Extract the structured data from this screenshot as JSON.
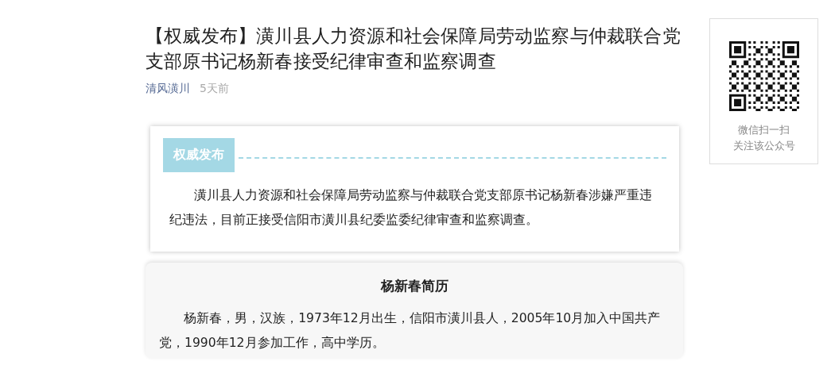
{
  "article": {
    "title": "【权威发布】潢川县人力资源和社会保障局劳动监察与仲裁联合党支部原书记杨新春接受纪律审查和监察调查",
    "author": "清风潢川",
    "time": "5天前"
  },
  "notice_card": {
    "tag": "权威发布",
    "text": "潢川县人力资源和社会保障局劳动监察与仲裁联合党支部原书记杨新春涉嫌严重违纪违法，目前正接受信阳市潢川县纪委监委纪律审查和监察调查。"
  },
  "bio_card": {
    "heading": "杨新春简历",
    "text": "杨新春，男，汉族，1973年12月出生，信阳市潢川县人，2005年10月加入中国共产党，1990年12月参加工作，高中学历。"
  },
  "qr_panel": {
    "lines": [
      "微信扫一扫",
      "关注该公众号"
    ]
  }
}
